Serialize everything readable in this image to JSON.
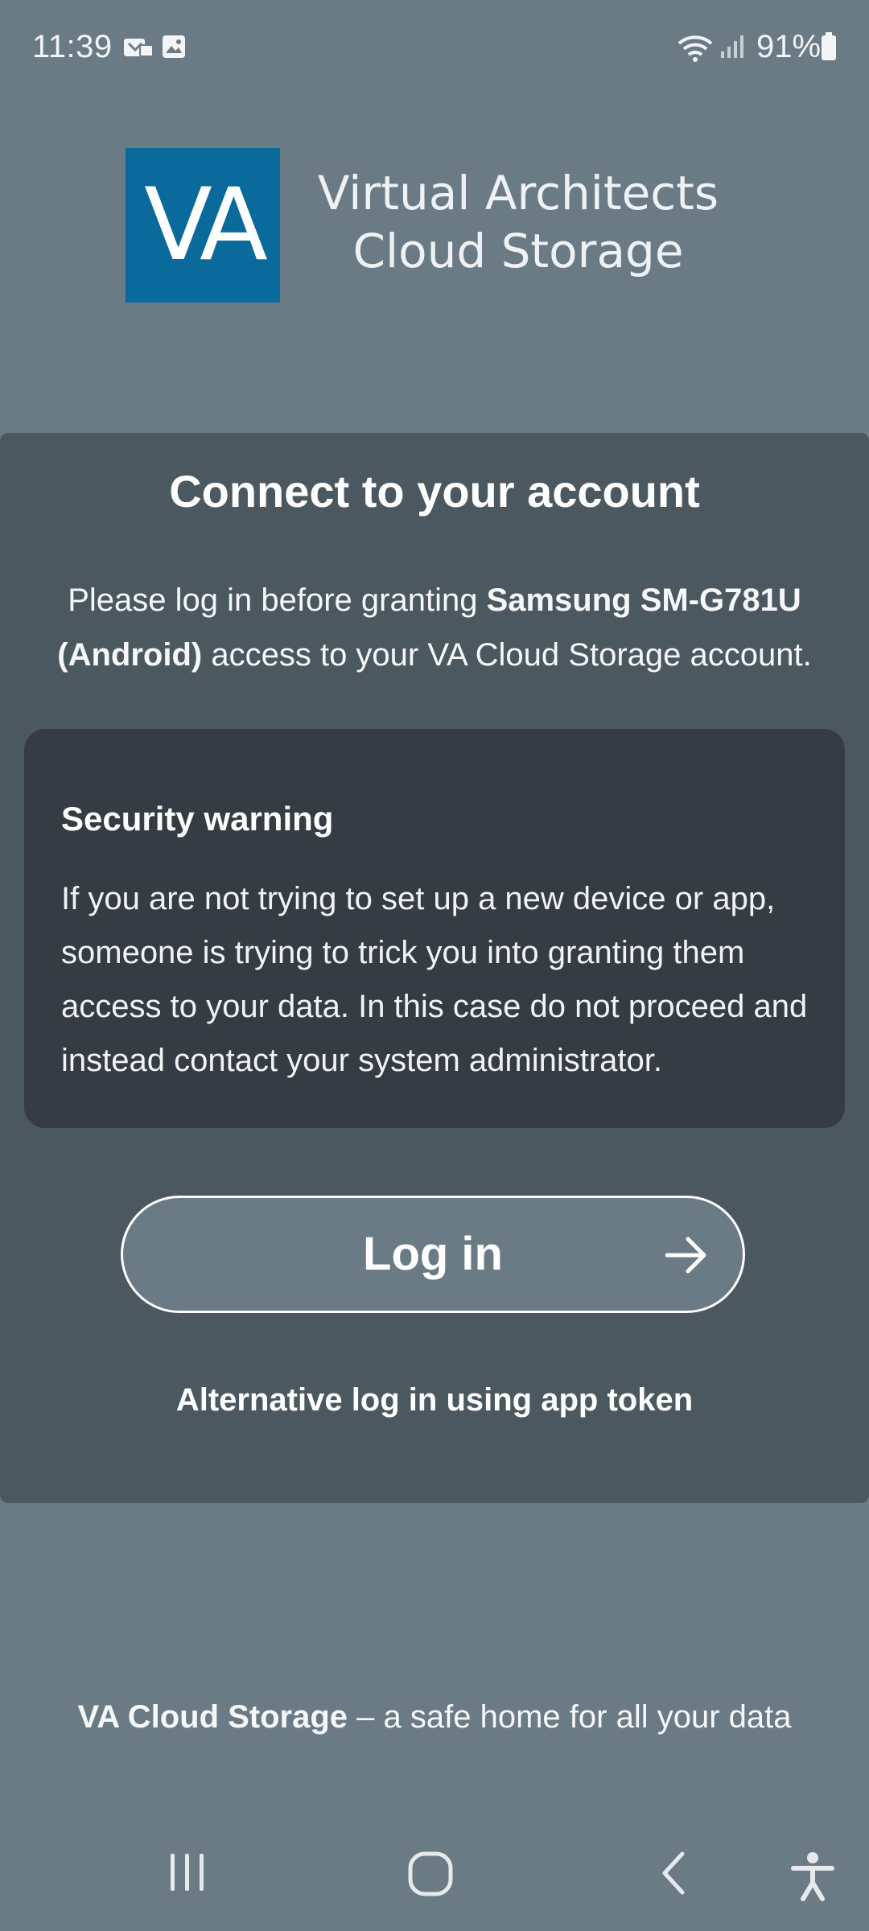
{
  "status_bar": {
    "time": "11:39",
    "battery": "91%",
    "icons": [
      "notification-icon",
      "gallery-icon",
      "wifi-icon",
      "signal-icon",
      "battery-icon"
    ]
  },
  "logo": {
    "mark": "VA",
    "line1": "Virtual Architects",
    "line2": "Cloud Storage",
    "color": "#0b6a9c"
  },
  "card": {
    "title": "Connect to your account",
    "desc_before": "Please log in before granting ",
    "device": "Samsung SM-G781U (Android)",
    "desc_after": " access to your VA Cloud Storage account.",
    "warning": {
      "title": "Security warning",
      "text": "If you are not trying to set up a new device or app, someone is trying to trick you into granting them access to your data. In this case do not proceed and instead contact your system administrator."
    },
    "login_label": "Log in",
    "alt_login": "Alternative log in using app token"
  },
  "footer": {
    "brand": "VA Cloud Storage",
    "tagline": " – a safe home for all your data"
  },
  "nav_bar": {
    "items": [
      "recents-icon",
      "home-icon",
      "back-icon",
      "accessibility-icon"
    ]
  },
  "colors": {
    "background": "#6b7b86",
    "card": "#4b5860",
    "warning_box": "#353c43"
  }
}
